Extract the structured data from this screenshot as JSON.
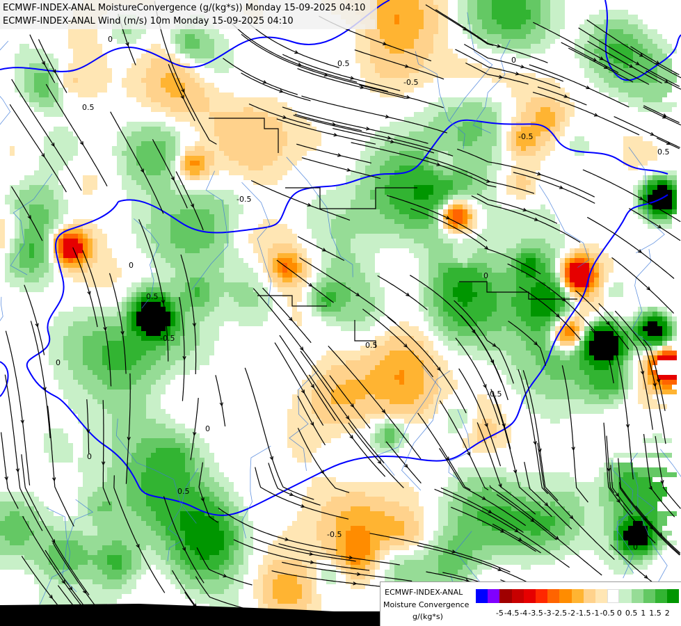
{
  "title": {
    "line1": "ECMWF-INDEX-ANAL MoistureConvergence (g/(kg*s)) Monday 15-09-2025 04:10",
    "line2": "ECMWF-INDEX-ANAL Wind (m/s) 10m Monday 15-09-2025 04:10"
  },
  "legend": {
    "model": "ECMWF-INDEX-ANAL",
    "variable": "Moisture Convergence",
    "unit": "g/(kg*s)",
    "colors": [
      "#0000ff",
      "#8000ff",
      "#a00000",
      "#c80000",
      "#e60000",
      "#ff2800",
      "#ff6400",
      "#ff8c00",
      "#ffb432",
      "#ffd28c",
      "#ffe6b4",
      "#ffffff",
      "#c8f0c8",
      "#96dc96",
      "#64c864",
      "#32b432",
      "#009600"
    ],
    "ticks": [
      "-5",
      "-4.5",
      "-4",
      "-3.5",
      "-3",
      "-2.5",
      "-2",
      "-1.5",
      "-1",
      "-0.5",
      "0",
      "0.5",
      "1",
      "1.5",
      "2"
    ]
  },
  "contour_labels": [
    "0",
    "0.5",
    "-0.5",
    "0",
    "0.5",
    "-0.5",
    "0",
    "0.5",
    "-0.5",
    "0",
    "0.5",
    "-0.5",
    "0",
    "0.5",
    "-0.5",
    "0",
    "0",
    "0.5",
    "-0.5",
    "0"
  ]
}
